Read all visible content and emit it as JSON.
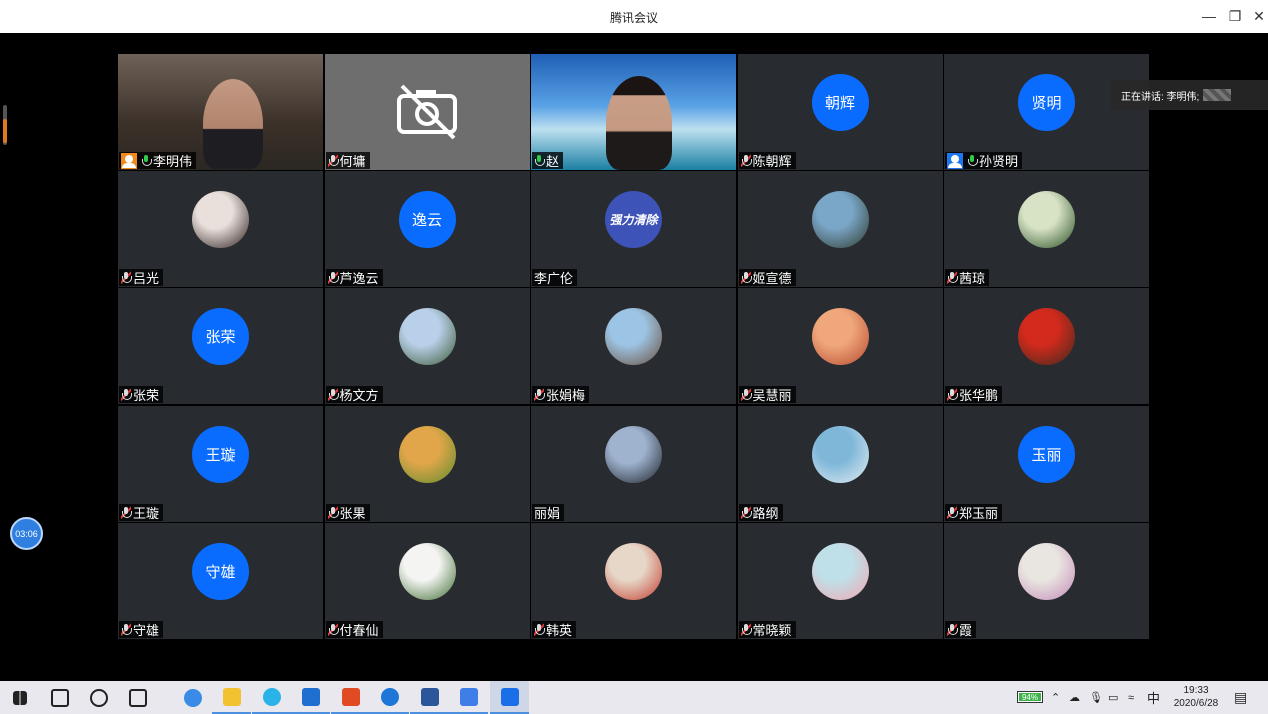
{
  "window": {
    "title": "腾讯会议"
  },
  "meeting": {
    "timer": "03:06",
    "speaking_label": "正在讲话: 李明伟;",
    "participants": [
      {
        "name": "李明伟",
        "kind": "video",
        "host": "orange",
        "mic": "on"
      },
      {
        "name": "何墉",
        "kind": "camoff",
        "mic": "muted"
      },
      {
        "name": "赵",
        "kind": "video",
        "mic": "on"
      },
      {
        "name": "陈朝辉",
        "kind": "text",
        "avatar": "朝辉",
        "mic": "muted"
      },
      {
        "name": "孙贤明",
        "kind": "text",
        "avatar": "贤明",
        "host": "blue",
        "mic": "on"
      },
      {
        "name": "吕光",
        "kind": "photo",
        "colors": [
          "#e9e0dc",
          "#2b1e1c"
        ],
        "mic": "muted"
      },
      {
        "name": "芦逸云",
        "kind": "text",
        "avatar": "逸云",
        "mic": "muted"
      },
      {
        "name": "李广伦",
        "kind": "logo",
        "avatar": "强力清除",
        "mic": "none"
      },
      {
        "name": "姬宣德",
        "kind": "photo",
        "colors": [
          "#7aa6c8",
          "#2f3b2c"
        ],
        "mic": "muted"
      },
      {
        "name": "茜琼",
        "kind": "photo",
        "colors": [
          "#d8e3c6",
          "#274d22"
        ],
        "mic": "muted"
      },
      {
        "name": "张荣",
        "kind": "text",
        "avatar": "张荣",
        "mic": "muted"
      },
      {
        "name": "杨文方",
        "kind": "photo",
        "colors": [
          "#b9d0ea",
          "#3c5b34"
        ],
        "mic": "muted"
      },
      {
        "name": "张娟梅",
        "kind": "photo",
        "colors": [
          "#9cc4e4",
          "#6b4e3a"
        ],
        "mic": "muted"
      },
      {
        "name": "吴慧丽",
        "kind": "photo",
        "colors": [
          "#f0a77b",
          "#b5492f"
        ],
        "mic": "muted"
      },
      {
        "name": "张华鹏",
        "kind": "photo",
        "colors": [
          "#d22a1c",
          "#3a2a1e"
        ],
        "mic": "muted"
      },
      {
        "name": "王璇",
        "kind": "text",
        "avatar": "王璇",
        "mic": "muted"
      },
      {
        "name": "张果",
        "kind": "photo",
        "colors": [
          "#e2a64a",
          "#5e8c2e"
        ],
        "mic": "muted"
      },
      {
        "name": "丽娟",
        "kind": "photo",
        "colors": [
          "#9fb3cf",
          "#1c2228"
        ],
        "mic": "none"
      },
      {
        "name": "路纲",
        "kind": "photo",
        "colors": [
          "#7fb7d9",
          "#e5eef2"
        ],
        "mic": "muted"
      },
      {
        "name": "郑玉丽",
        "kind": "text",
        "avatar": "玉丽",
        "mic": "muted"
      },
      {
        "name": "守雄",
        "kind": "text",
        "avatar": "守雄",
        "mic": "muted"
      },
      {
        "name": "付春仙",
        "kind": "photo",
        "colors": [
          "#f4f4f2",
          "#3b6b2f"
        ],
        "mic": "muted"
      },
      {
        "name": "韩英",
        "kind": "photo",
        "colors": [
          "#e7d7c8",
          "#c23a2b"
        ],
        "mic": "muted"
      },
      {
        "name": "常晓颖",
        "kind": "photo",
        "colors": [
          "#bfe0e9",
          "#f2a6b0"
        ],
        "mic": "muted"
      },
      {
        "name": "霞",
        "kind": "photo",
        "colors": [
          "#e9e6e1",
          "#c489b8"
        ],
        "mic": "muted"
      }
    ]
  },
  "taskbar": {
    "battery": "94%",
    "ime": "中",
    "time": "19:33",
    "date": "2020/6/28",
    "apps": [
      {
        "id": "start",
        "color": "#222"
      },
      {
        "id": "search",
        "color": "#222"
      },
      {
        "id": "cortana",
        "color": "#222"
      },
      {
        "id": "taskview",
        "color": "#222"
      },
      {
        "id": "clock-app",
        "color": "#3a8be8"
      },
      {
        "id": "explorer",
        "color": "#f2c230"
      },
      {
        "id": "browser-360",
        "color": "#2ab3e8"
      },
      {
        "id": "mail",
        "color": "#1f6fd0"
      },
      {
        "id": "office",
        "color": "#e04b23"
      },
      {
        "id": "edge",
        "color": "#1e77d6"
      },
      {
        "id": "word",
        "color": "#2b579a"
      },
      {
        "id": "feishu",
        "color": "#3f7de8"
      },
      {
        "id": "tencent-meeting",
        "color": "#1a6fe8"
      }
    ]
  }
}
